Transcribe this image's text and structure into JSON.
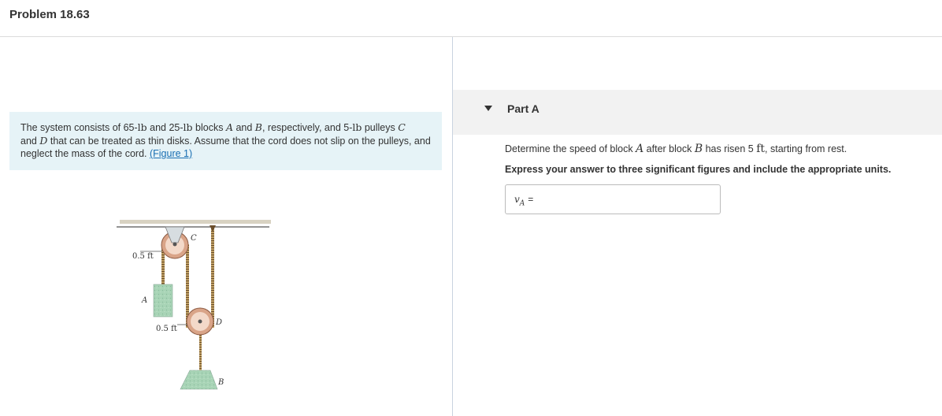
{
  "header": {
    "title": "Problem 18.63"
  },
  "problem": {
    "t1": "The system consists of 65-",
    "u1": "lb",
    "t2": " and 25-",
    "u2": "lb",
    "t3": " blocks ",
    "v1": "A",
    "t4": " and ",
    "v2": "B",
    "t5": ", respectively, and 5-",
    "u3": "lb",
    "t6": " pulleys ",
    "v3": "C",
    "t7": "and ",
    "v4": "D",
    "t8": " that can be treated as thin disks. Assume that the cord does not slip on the pulleys, and neglect the mass of the cord. ",
    "link": "(Figure 1)"
  },
  "figure": {
    "dim_top": "0.5 ft",
    "dim_bottom": "0.5 ft",
    "label_c": "C",
    "label_d": "D",
    "label_a": "A",
    "label_b": "B"
  },
  "part": {
    "label": "Part A"
  },
  "question": {
    "q1": "Determine the speed of block ",
    "qv1": "A",
    "q2": " after block ",
    "qv2": "B",
    "q3": " has risen 5 ",
    "qu": "ft",
    "q4": ", starting from rest.",
    "instruction": "Express your answer to three significant figures and include the appropriate units."
  },
  "answer": {
    "var": "v",
    "sub": "A",
    "eq": "="
  },
  "colors": {
    "problem_bg": "#e6f3f7",
    "link": "#1a6fb3",
    "part_bar": "#f2f2f2"
  }
}
